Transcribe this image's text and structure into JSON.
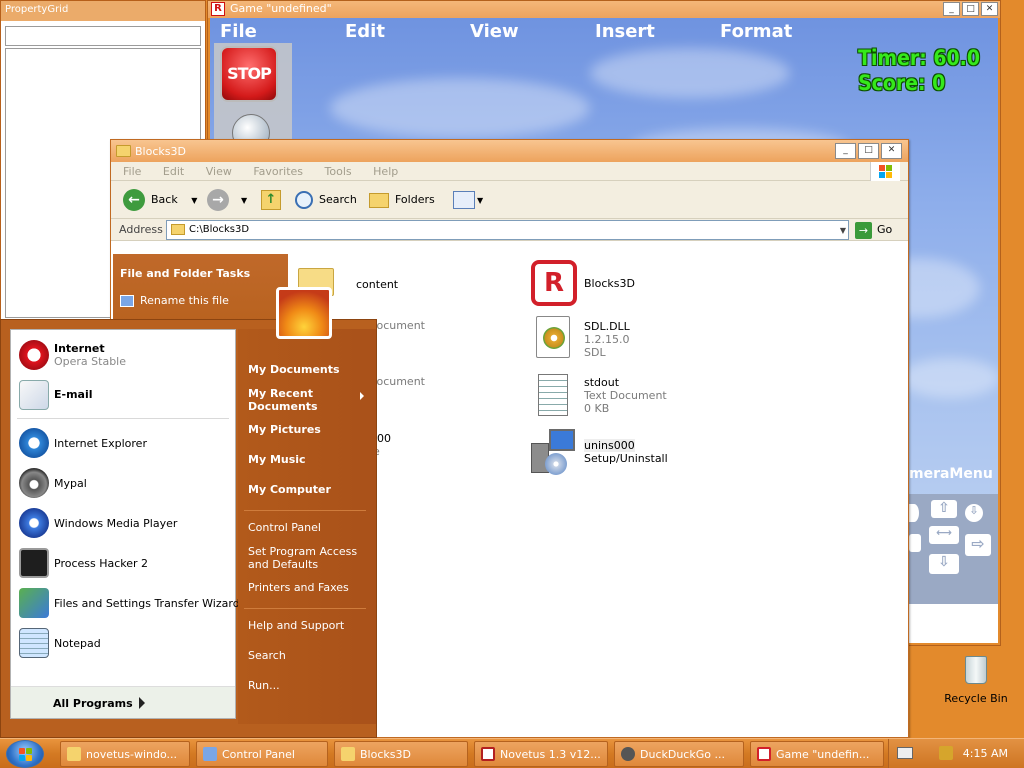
{
  "property_grid": {
    "title": "PropertyGrid"
  },
  "game_window": {
    "title": "Game \"undefined\"",
    "menu": [
      "File",
      "Edit",
      "View",
      "Insert",
      "Format"
    ],
    "stop_label": "STOP",
    "hud": {
      "timer": "Timer: 60.0",
      "score": "Score: 0"
    },
    "camera_menu_label": "meraMenu"
  },
  "explorer": {
    "title": "Blocks3D",
    "menu": [
      "File",
      "Edit",
      "View",
      "Favorites",
      "Tools",
      "Help"
    ],
    "toolbar": {
      "back": "Back",
      "search": "Search",
      "folders": "Folders"
    },
    "address_label": "Address",
    "address_value": "C:\\Blocks3D",
    "go_label": "Go",
    "tasks_header": "File and Folder Tasks",
    "task_rename": "Rename this file",
    "files": [
      {
        "name": "content",
        "line2": "",
        "line3": ""
      },
      {
        "name": "Blocks3D",
        "line2": "",
        "line3": ""
      },
      {
        "name": "",
        "line2": "Document",
        "line3": ""
      },
      {
        "name": "SDL.DLL",
        "line2": "1.2.15.0",
        "line3": "SDL"
      },
      {
        "name": "",
        "line2": "Document",
        "line3": ""
      },
      {
        "name": "stdout",
        "line2": "Text Document",
        "line3": "0 KB"
      },
      {
        "name": "000",
        "line2": "le",
        "line3": ""
      },
      {
        "name": "unins000",
        "line2": "Setup/Uninstall",
        "line3": ""
      }
    ]
  },
  "start_menu": {
    "pinned": [
      {
        "title": "Internet",
        "subtitle": "Opera Stable"
      },
      {
        "title": "E-mail",
        "subtitle": ""
      }
    ],
    "recent": [
      "Internet Explorer",
      "Mypal",
      "Windows Media Player",
      "Process Hacker 2",
      "Files and Settings Transfer Wizard",
      "Notepad"
    ],
    "all_programs": "All Programs",
    "right": {
      "my_documents": "My Documents",
      "my_recent_documents": "My Recent Documents",
      "my_pictures": "My Pictures",
      "my_music": "My Music",
      "my_computer": "My Computer",
      "control_panel": "Control Panel",
      "set_program_access": "Set Program Access and Defaults",
      "printers_faxes": "Printers and Faxes",
      "help_support": "Help and Support",
      "search": "Search",
      "run": "Run..."
    }
  },
  "taskbar": {
    "buttons": [
      "novetus-windo...",
      "Control Panel",
      "Blocks3D",
      "Novetus 1.3 v12...",
      "DuckDuckGo ...",
      "Game \"undefin..."
    ],
    "clock": "4:15 AM"
  },
  "desktop": {
    "recycle_bin": "Recycle Bin"
  }
}
